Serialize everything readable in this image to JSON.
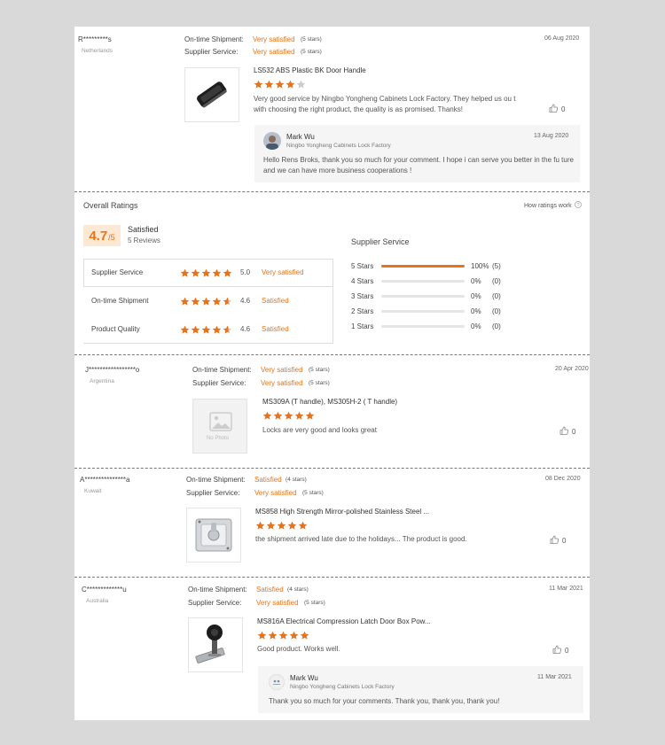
{
  "reviews": [
    {
      "user": "R*********s",
      "country": "Netherlands",
      "date": "06 Aug 2020",
      "ontime_label": "On-time Shipment:",
      "ontime_value": "Very satisfied",
      "ontime_stars": "(5 stars)",
      "service_label": "Supplier Service:",
      "service_value": "Very satisfied",
      "service_stars": "(5 stars)",
      "product": "LS532 ABS Plastic BK Door Handle",
      "rating": 4,
      "text": "Very good service by Ningbo Yongheng Cabinets Lock Factory. They helped us ou t with choosing the right product, the quality is as promised. Thanks!",
      "likes": "0",
      "reply": {
        "name": "Mark Wu",
        "company": "Ningbo Yongheng Cabinets Lock Factory",
        "date": "13 Aug 2020",
        "text": "Hello Rens Broks, thank you so much for your comment. I hope i can serve you better in the fu ture and we can have more business cooperations !"
      }
    },
    {
      "user": "J*****************o",
      "country": "Argentina",
      "date": "20 Apr 2020",
      "ontime_label": "On-time Shipment:",
      "ontime_value": "Very satisfied",
      "ontime_stars": "(5 stars)",
      "service_label": "Supplier Service:",
      "service_value": "Very satisfied",
      "service_stars": "(5 stars)",
      "product": "MS309A (T handle), MS305H-2 ( T handle)",
      "rating": 5,
      "text": "Locks are very good and looks great",
      "likes": "0",
      "no_photo": "No Photo"
    },
    {
      "user": "A***************a",
      "country": "Kuwait",
      "date": "08 Dec 2020",
      "ontime_label": "On-time Shipment:",
      "ontime_value": "Satisfied",
      "ontime_stars": "(4 stars)",
      "service_label": "Supplier Service:",
      "service_value": "Very satisfied",
      "service_stars": "(5 stars)",
      "product": "MS858 High Strength Mirror-polished Stainless Steel ...",
      "rating": 5,
      "text": "the shipment arrived late due to the holidays... The product is good.",
      "likes": "0"
    },
    {
      "user": "C*************u",
      "country": "Australia",
      "date": "11 Mar 2021",
      "ontime_label": "On-time Shipment:",
      "ontime_value": "Satisfied",
      "ontime_stars": "(4 stars)",
      "service_label": "Supplier Service:",
      "service_value": "Very satisfied",
      "service_stars": "(5 stars)",
      "product": "MS816A Electrical Compression Latch Door Box Pow...",
      "rating": 5,
      "text": "Good product. Works well.",
      "likes": "0",
      "reply": {
        "name": "Mark Wu",
        "company": "Ningbo Yongheng Cabinets Lock Factory",
        "date": "11 Mar 2021",
        "text": "Thank you so much for your comments. Thank you, thank you, thank you!"
      }
    }
  ],
  "overall": {
    "title": "Overall Ratings",
    "how_link": "How ratings work",
    "score": "4.7",
    "score_suffix": "/5",
    "label": "Satisfied",
    "count": "5 Reviews",
    "rows": [
      {
        "name": "Supplier Service",
        "score": "5.0",
        "rating": 5.0,
        "verdict": "Very satisfied"
      },
      {
        "name": "On-time Shipment",
        "score": "4.6",
        "rating": 4.6,
        "verdict": "Satisfied"
      },
      {
        "name": "Product Quality",
        "score": "4.6",
        "rating": 4.6,
        "verdict": "Satisfied"
      }
    ],
    "breakdown_title": "Supplier Service",
    "breakdown": [
      {
        "label": "5 Stars",
        "fraction": 1.0,
        "pct": "100%",
        "count": "(5)"
      },
      {
        "label": "4 Stars",
        "fraction": 0,
        "pct": "0%",
        "count": "(0)"
      },
      {
        "label": "3 Stars",
        "fraction": 0,
        "pct": "0%",
        "count": "(0)"
      },
      {
        "label": "2 Stars",
        "fraction": 0,
        "pct": "0%",
        "count": "(0)"
      },
      {
        "label": "1 Stars",
        "fraction": 0,
        "pct": "0%",
        "count": "(0)"
      }
    ]
  },
  "colors": {
    "accent": "#e8731a",
    "star_empty": "#cccccc"
  }
}
